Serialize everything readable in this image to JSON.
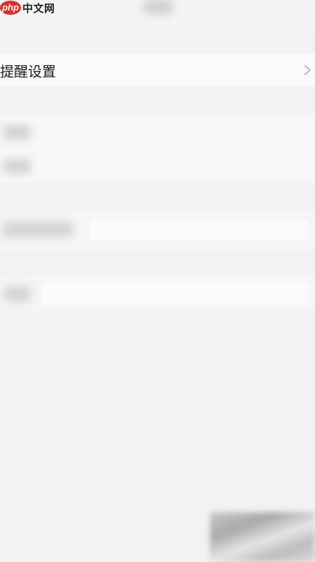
{
  "watermark": {
    "badge": "php",
    "text": "中文网"
  },
  "settings": {
    "reminder_label": "提醒设置",
    "chevron_icon": "chevron-right-icon"
  },
  "colors": {
    "watermark_red": "#e02a2a",
    "background": "#f2f2f2",
    "row_background": "#fafafa"
  }
}
